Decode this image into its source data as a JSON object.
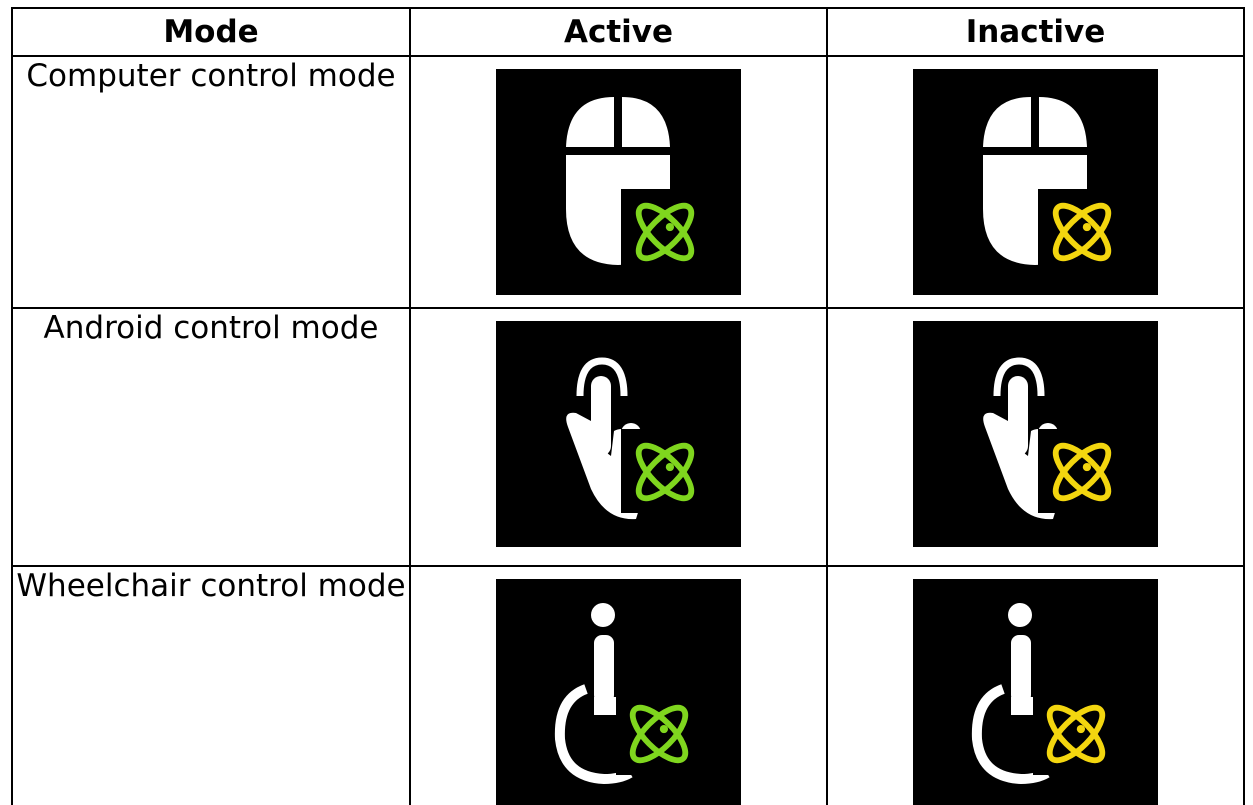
{
  "header": {
    "mode": "Mode",
    "active": "Active",
    "inactive": "Inactive"
  },
  "rows": [
    {
      "mode": "Computer control mode",
      "icon": "mouse-icon"
    },
    {
      "mode": "Android control mode",
      "icon": "tap-hand-icon"
    },
    {
      "mode": "Wheelchair control mode",
      "icon": "wheelchair-icon"
    }
  ],
  "badge_icon": "atom-icon",
  "colors": {
    "active_badge": "#7fd61e",
    "inactive_badge": "#f3d60f",
    "tile_bg": "#000000",
    "glyph": "#ffffff"
  }
}
